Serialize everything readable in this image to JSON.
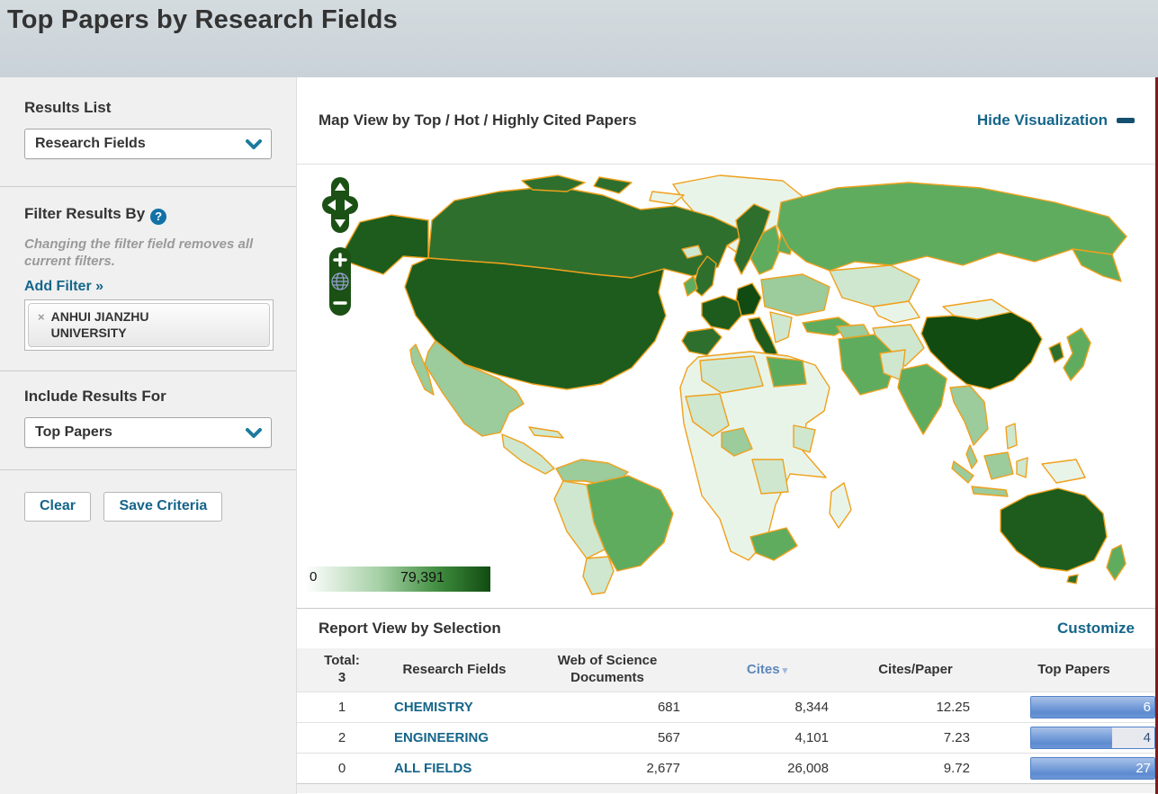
{
  "page": {
    "title": "Top Papers by Research Fields"
  },
  "sidebar": {
    "results_list": {
      "label": "Results List",
      "selected": "Research Fields"
    },
    "filter": {
      "label": "Filter Results By",
      "note": "Changing the filter field removes all current filters.",
      "add_filter": "Add Filter »",
      "chip": {
        "remove": "×",
        "line1": "ANHUI JIANZHU",
        "line2": "UNIVERSITY"
      }
    },
    "include": {
      "label": "Include Results For",
      "selected": "Top Papers"
    },
    "buttons": {
      "clear": "Clear",
      "save": "Save Criteria"
    }
  },
  "map": {
    "title": "Map View by Top / Hot / Highly Cited Papers",
    "hide_link": "Hide Visualization",
    "legend": {
      "min": "0",
      "max": "79,391"
    },
    "colors": {
      "border": "#efa11c",
      "level0": "#e9f4e9",
      "level1": "#cfe7cf",
      "level2": "#9ccb9c",
      "level3": "#5fac5f",
      "level4": "#2e6f2e",
      "level5": "#1d5c1d",
      "level6": "#114b11",
      "control": "#1b5114",
      "globe": "#9aa0d6"
    }
  },
  "report": {
    "title": "Report View by Selection",
    "customize": "Customize",
    "table": {
      "headers": {
        "total_label": "Total:",
        "total_count": "3",
        "field": "Research Fields",
        "docs": "Web of Science Documents",
        "cites": "Cites",
        "sort_icon": "▾",
        "cites_per_paper": "Cites/Paper",
        "top_papers": "Top Papers"
      },
      "rows": [
        {
          "rank": "1",
          "field": "CHEMISTRY",
          "docs": "681",
          "cites": "8,344",
          "cites_per_paper": "12.25",
          "top_papers": "6",
          "bar_pct": "100%"
        },
        {
          "rank": "2",
          "field": "ENGINEERING",
          "docs": "567",
          "cites": "4,101",
          "cites_per_paper": "7.23",
          "top_papers": "4",
          "bar_pct": "66%"
        },
        {
          "rank": "0",
          "field": "ALL FIELDS",
          "docs": "2,677",
          "cites": "26,008",
          "cites_per_paper": "9.72",
          "top_papers": "27",
          "bar_pct": "100%"
        }
      ]
    }
  }
}
